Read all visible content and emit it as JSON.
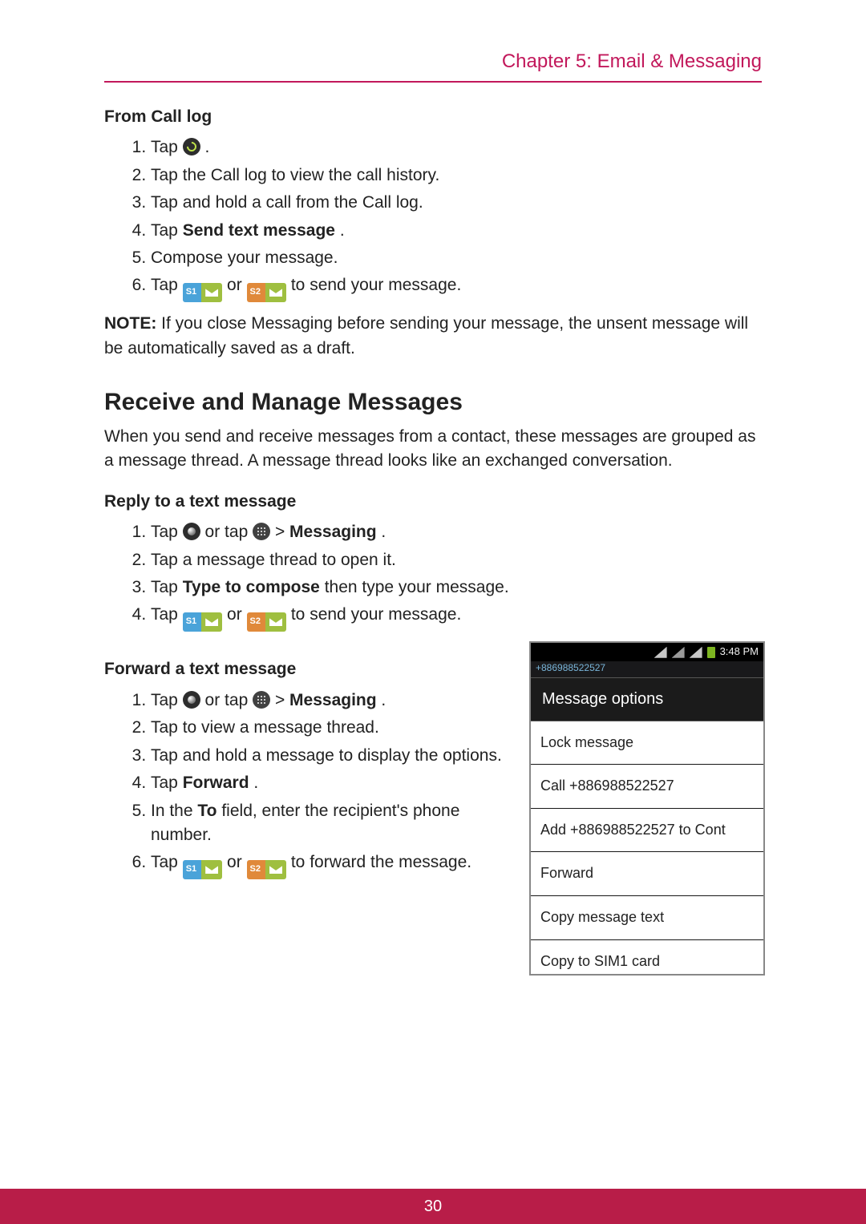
{
  "header": {
    "chapter_title": "Chapter 5: Email & Messaging"
  },
  "from_call_log": {
    "heading": "From Call log",
    "steps": {
      "s1_pre": "Tap ",
      "s1_post": ".",
      "s2": "Tap the Call log to view the call history.",
      "s3": "Tap and hold a call from the Call log.",
      "s4_pre": "Tap ",
      "s4_bold": "Send text message",
      "s4_post": ".",
      "s5": "Compose your message.",
      "s6_pre": "Tap ",
      "s6_mid": " or ",
      "s6_post": " to send your message."
    }
  },
  "note": {
    "label": "NOTE:",
    "text": "If you close Messaging before sending your message, the unsent message will be automatically saved as a draft."
  },
  "section2": {
    "heading": "Receive and Manage Messages",
    "intro": "When you send and receive messages from a contact, these messages are grouped as a message thread. A message thread looks like an exchanged conversation."
  },
  "reply": {
    "heading": "Reply to a text message",
    "steps": {
      "s1_pre": "Tap ",
      "s1_mid": " or tap ",
      "s1_gt": "  >  ",
      "s1_bold": "Messaging",
      "s1_post": ".",
      "s2": "Tap a message thread to open it.",
      "s3_pre": "Tap ",
      "s3_bold": "Type to compose",
      "s3_post": " then type your message.",
      "s4_pre": "Tap ",
      "s4_mid": " or ",
      "s4_post": " to send your message."
    }
  },
  "forward": {
    "heading": "Forward a text message",
    "steps": {
      "s1_pre": "Tap ",
      "s1_mid": " or tap ",
      "s1_gt": "  >  ",
      "s1_bold": "Messaging",
      "s1_post": ".",
      "s2": "Tap to view a message thread.",
      "s3": "Tap and hold a message to display the options.",
      "s4_pre": "Tap ",
      "s4_bold": "Forward",
      "s4_post": ".",
      "s5_pre": "In the ",
      "s5_bold": "To",
      "s5_post": " field, enter the recipient's phone number.",
      "s6_pre": "Tap ",
      "s6_mid": " or ",
      "s6_post": " to forward the message."
    }
  },
  "sim": {
    "s1_label": "S1",
    "s2_label": "S2"
  },
  "phone": {
    "time": "3:48 PM",
    "thread_number": "+886988522527",
    "options_title": "Message options",
    "options": [
      "Lock message",
      "Call +886988522527",
      "Add +886988522527 to Cont",
      "Forward",
      "Copy message text",
      "Copy to SIM1 card"
    ]
  },
  "footer": {
    "page_number": "30"
  }
}
